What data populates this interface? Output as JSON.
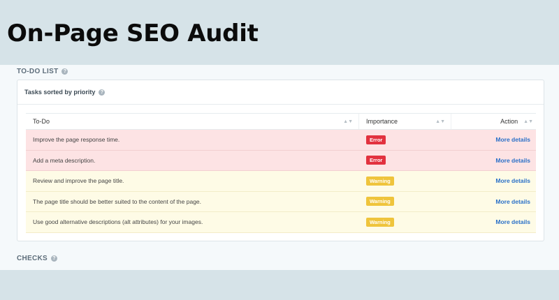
{
  "page_title": "On-Page SEO Audit",
  "todo_section": {
    "label": "TO-DO LIST"
  },
  "card": {
    "title": "Tasks sorted by priority"
  },
  "table": {
    "columns": [
      "To-Do",
      "Importance",
      "Action"
    ],
    "rows": [
      {
        "task": "Improve the page response time.",
        "importance": "Error",
        "action": "More details"
      },
      {
        "task": "Add a meta description.",
        "importance": "Error",
        "action": "More details"
      },
      {
        "task": "Review and improve the page title.",
        "importance": "Warning",
        "action": "More details"
      },
      {
        "task": "The page title should be better suited to the content of the page.",
        "importance": "Warning",
        "action": "More details"
      },
      {
        "task": "Use good alternative descriptions (alt attributes) for your images.",
        "importance": "Warning",
        "action": "More details"
      }
    ]
  },
  "checks_section": {
    "label": "CHECKS"
  },
  "colors": {
    "error_badge": "#e2323f",
    "warning_badge": "#efc43c",
    "error_row": "#fde3e4",
    "warning_row": "#fefbe6",
    "link": "#2a70c8"
  },
  "icons": {
    "help": "question-circle-icon",
    "sort": "sort-arrows-icon"
  }
}
